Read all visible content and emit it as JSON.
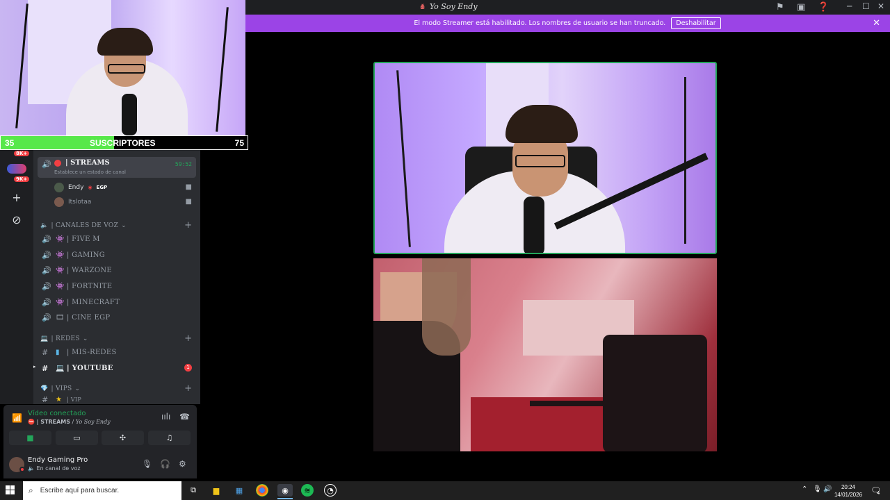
{
  "window": {
    "title": "Yo Soy Endy"
  },
  "banner": {
    "message": "El modo Streamer está habilitado. Los nombres de usuario se han truncado.",
    "button": "Deshabilitar"
  },
  "webcam_overlay": {
    "left_count": "35",
    "label": "SUSCRIPTORES",
    "right_count": "75",
    "progress": 0.46
  },
  "server_rail": {
    "badges": [
      "8K+",
      "9K+"
    ]
  },
  "sidebar": {
    "active_channel": {
      "name": "| STREAMS",
      "status": "Establece un estado de canal",
      "timer": "59:52"
    },
    "voice_users": [
      {
        "name": "Endy",
        "tag": "EGP"
      },
      {
        "name": "Itslotaa",
        "tag": ""
      }
    ],
    "categories": {
      "voice": "| CANALES DE VOZ",
      "redes": "| REDES",
      "vips": "| VIPS"
    },
    "voice_channels": [
      "| FIVE M",
      "|  GAMING",
      "| WARZONE",
      "| FORTNITE",
      "| MINECRAFT",
      "| CINE EGP"
    ],
    "redes_channels": [
      {
        "name": "| MIS-REDES",
        "unread": false
      },
      {
        "name": "| YOUTUBE",
        "unread": true,
        "badge": "1"
      }
    ],
    "vip_channel": "| VIP"
  },
  "voice_panel": {
    "title": "Vídeo conectado",
    "channel": "| STREAMS",
    "server": "Yo Soy Endy"
  },
  "user": {
    "name": "Endy Gaming Pro",
    "status": "En canal de voz"
  },
  "taskbar": {
    "search_placeholder": "Escribe aquí para buscar.",
    "time": "20:24",
    "date": "14/01/2026",
    "notifications": "4"
  },
  "colors": {
    "banner": "#9b44e6",
    "speaking_border": "#23a55a",
    "sub_bar": "#57e84a"
  }
}
